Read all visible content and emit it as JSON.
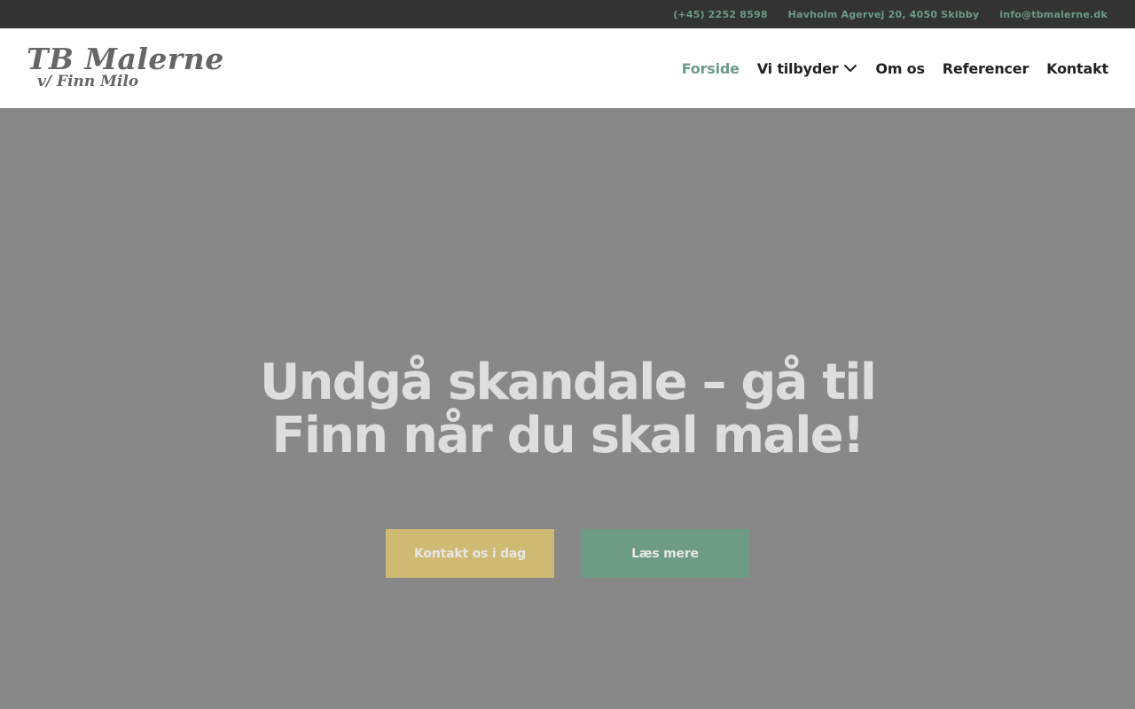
{
  "colors": {
    "topbar_bg": "#333333",
    "accent_green": "#6b9b85",
    "accent_gold": "#cfba74",
    "hero_bg": "#888888",
    "hero_text": "#dedede"
  },
  "topbar": {
    "phone": "(+45) 2252 8598",
    "address": "Havholm Agervej 20, 4050 Skibby",
    "email": "info@tbmalerne.dk"
  },
  "logo": {
    "main": "TB Malerne",
    "sub": "v/ Finn Milo"
  },
  "nav": {
    "items": [
      {
        "label": "Forside",
        "active": true
      },
      {
        "label": "Vi tilbyder",
        "has_dropdown": true,
        "icon": "chevron-down-icon"
      },
      {
        "label": "Om os"
      },
      {
        "label": "Referencer"
      },
      {
        "label": "Kontakt"
      }
    ]
  },
  "hero": {
    "title_line1": "Undgå skandale – gå til",
    "title_line2": "Finn når du skal male!",
    "primary_button": "Kontakt os i dag",
    "secondary_button": "Læs mere"
  }
}
